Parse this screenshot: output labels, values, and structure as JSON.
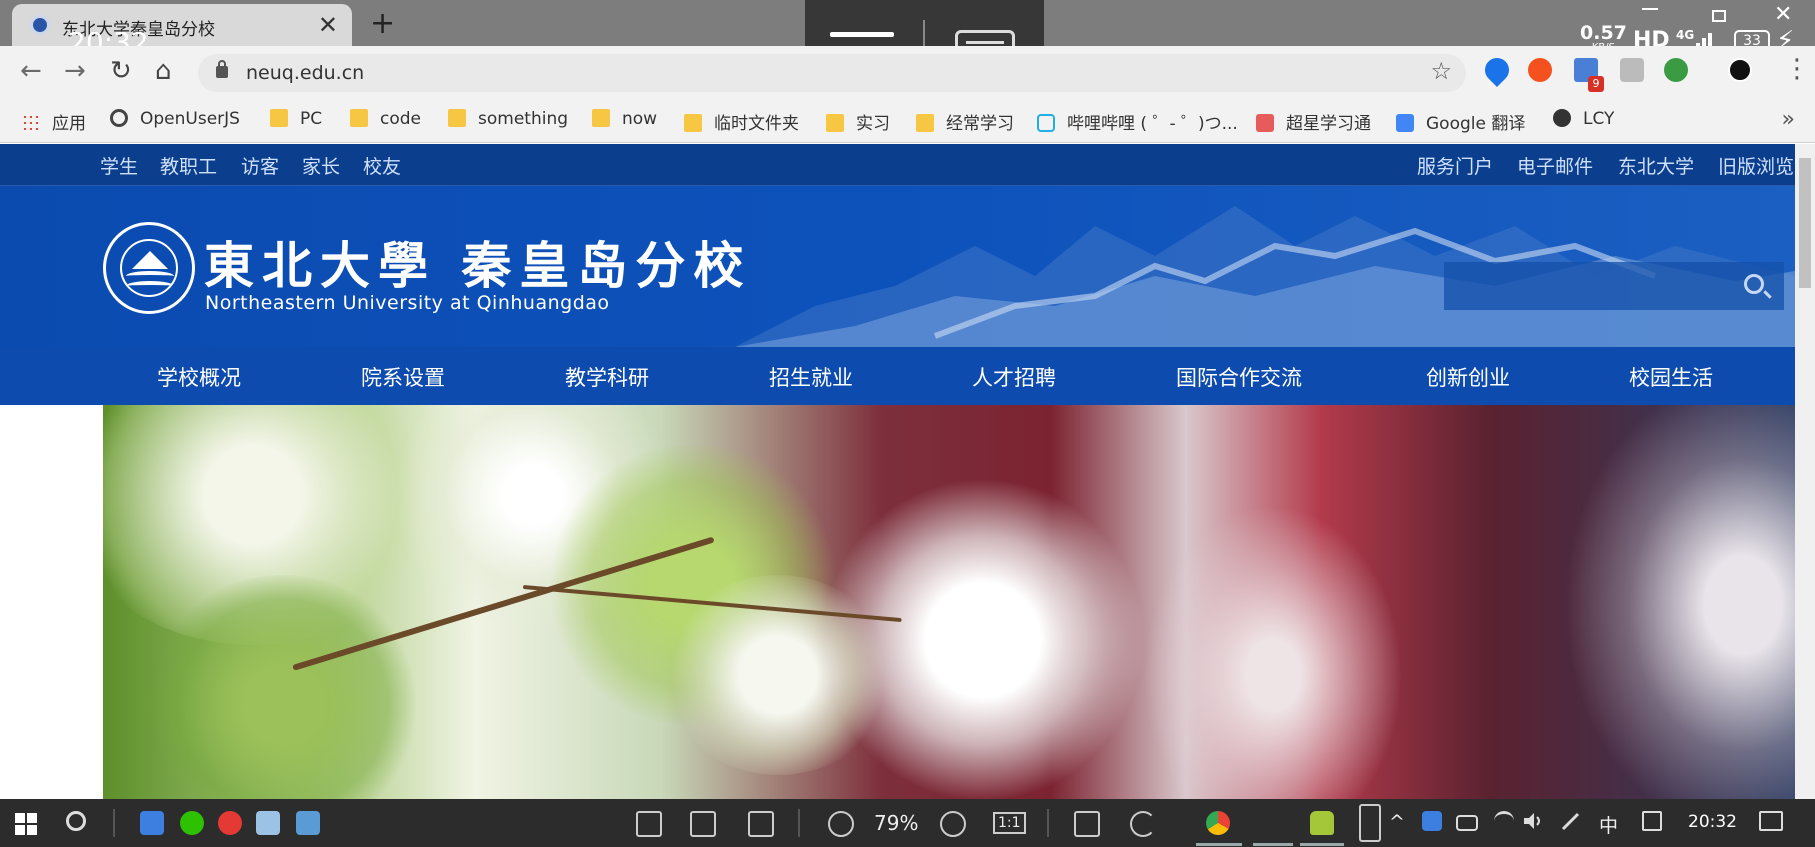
{
  "browser": {
    "tab_title": "东北大学秦皇岛分校",
    "tab_close": "✕",
    "new_tab": "+",
    "url": "neuq.edu.cn",
    "ext_badge": "9"
  },
  "phone_status": {
    "time": "20:32",
    "net_speed": "0.57",
    "net_unit": "KB/S",
    "hd": "HD",
    "network": "4G",
    "battery": "33"
  },
  "bookmarks": [
    {
      "label": "应用",
      "icon": "apps-icon"
    },
    {
      "label": "OpenUserJS",
      "icon": "openuserjs-icon"
    },
    {
      "label": "PC",
      "icon": "folder-icon"
    },
    {
      "label": "code",
      "icon": "folder-icon"
    },
    {
      "label": "something",
      "icon": "folder-icon"
    },
    {
      "label": "now",
      "icon": "folder-icon"
    },
    {
      "label": "临时文件夹",
      "icon": "folder-icon"
    },
    {
      "label": "实习",
      "icon": "folder-icon"
    },
    {
      "label": "经常学习",
      "icon": "folder-icon"
    },
    {
      "label": "哔哩哔哩 ( ゜- ゜)つ...",
      "icon": "bilibili-icon"
    },
    {
      "label": "超星学习通",
      "icon": "chaoxing-icon"
    },
    {
      "label": "Google 翻译",
      "icon": "google-translate-icon"
    },
    {
      "label": "LCY",
      "icon": "lcy-icon"
    }
  ],
  "bookmarks_more": "»",
  "site": {
    "top_left_links": [
      "学生",
      "教职工",
      "访客",
      "家长",
      "校友"
    ],
    "top_right_links": [
      "服务门户",
      "电子邮件",
      "东北大学",
      "旧版浏览"
    ],
    "logo_cn": "東北大學 秦皇岛分校",
    "logo_en": "Northeastern University at Qinhuangdao",
    "search_placeholder": "",
    "nav": [
      "学校概况",
      "院系设置",
      "教学科研",
      "招生就业",
      "人才招聘",
      "国际合作交流",
      "创新创业",
      "校园生活"
    ]
  },
  "taskbar": {
    "zoom": "79%",
    "ratio": "1:1",
    "ime": "中",
    "time": "20:32"
  },
  "colors": {
    "brand_blue": "#0d4cae",
    "topbar_blue": "#0b3f8d"
  }
}
